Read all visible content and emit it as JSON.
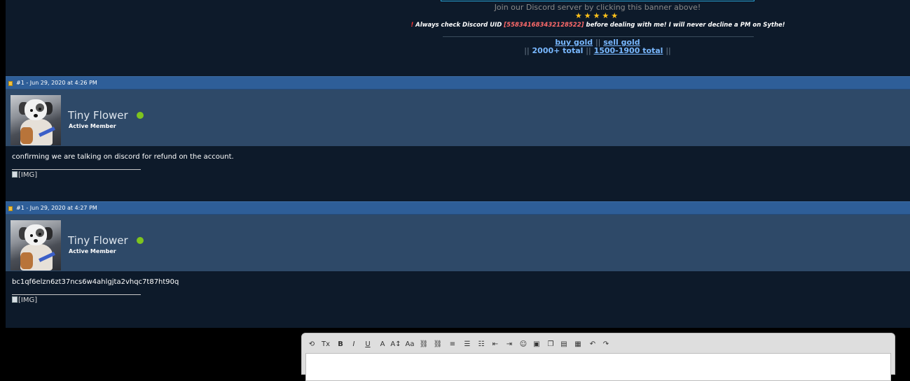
{
  "signature": {
    "discord_text": "Join our Discord server by clicking this banner above!",
    "stars": "★★★★★",
    "warning": {
      "exclamation": "!",
      "before": "Always check Discord UID",
      "uid": "[558341683432128522]",
      "after": "before dealing with me! I will never decline a PM on Sythe!"
    },
    "links_row1": {
      "buy": "buy gold",
      "sep": "||",
      "sell": "sell gold"
    },
    "links_row2": {
      "open": "||",
      "a": "2000+ total",
      "mid": "||",
      "b": "1500-1900 total",
      "close": "||"
    }
  },
  "posts": [
    {
      "meta": "#1 - Jun 29, 2020 at 4:26 PM",
      "username": "Tiny Flower",
      "usertitle": "Active Member",
      "body": "confirming we are talking on discord for refund on the account.",
      "image_alt": "[IMG]"
    },
    {
      "meta": "#1 - Jun 29, 2020 at 4:27 PM",
      "username": "Tiny Flower",
      "usertitle": "Active Member",
      "body": "bc1qf6elzn6zt37ncs6w4ahlgjta2vhqc7t87ht90q",
      "image_alt": "[IMG]"
    }
  ],
  "editor": {
    "toolbar": [
      {
        "name": "remove-format-icon",
        "glyph": "⟲"
      },
      {
        "name": "clear-format-icon",
        "glyph": "Tx"
      },
      {
        "name": "bold-icon",
        "glyph": "B"
      },
      {
        "name": "italic-icon",
        "glyph": "I"
      },
      {
        "name": "underline-icon",
        "glyph": "U"
      },
      {
        "name": "font-color-icon",
        "glyph": "A"
      },
      {
        "name": "font-size-icon",
        "glyph": "A↕"
      },
      {
        "name": "font-family-icon",
        "glyph": "Aa"
      },
      {
        "name": "link-icon",
        "glyph": "⛓"
      },
      {
        "name": "unlink-icon",
        "glyph": "⛓"
      },
      {
        "name": "align-icon",
        "glyph": "≡"
      },
      {
        "name": "bullet-list-icon",
        "glyph": "☰"
      },
      {
        "name": "numbered-list-icon",
        "glyph": "☷"
      },
      {
        "name": "outdent-icon",
        "glyph": "⇤"
      },
      {
        "name": "indent-icon",
        "glyph": "⇥"
      },
      {
        "name": "smiley-icon",
        "glyph": "☺"
      },
      {
        "name": "image-icon",
        "glyph": "▣"
      },
      {
        "name": "media-icon",
        "glyph": "❐"
      },
      {
        "name": "insert-icon",
        "glyph": "▤"
      },
      {
        "name": "save-draft-icon",
        "glyph": "▦"
      },
      {
        "name": "undo-icon",
        "glyph": "↶"
      },
      {
        "name": "redo-icon",
        "glyph": "↷"
      }
    ]
  }
}
